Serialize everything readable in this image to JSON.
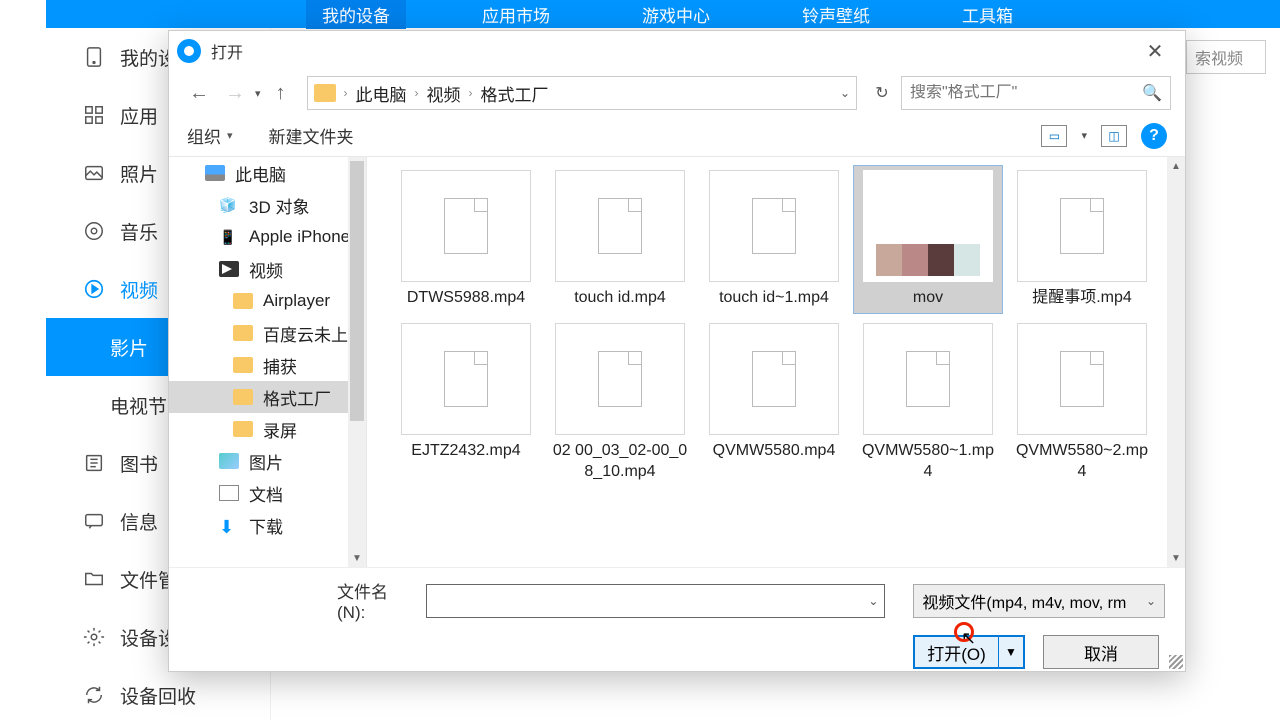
{
  "top_nav": {
    "items": [
      "我的设备",
      "应用市场",
      "游戏中心",
      "铃声壁纸",
      "工具箱"
    ],
    "active_index": 0
  },
  "search_bg_placeholder": "索视频",
  "sidebar": {
    "items": [
      {
        "label": "我的设",
        "icon": "device"
      },
      {
        "label": "应用",
        "icon": "apps"
      },
      {
        "label": "照片",
        "icon": "photo"
      },
      {
        "label": "音乐",
        "icon": "music"
      },
      {
        "label": "视频",
        "icon": "video",
        "active": true
      },
      {
        "label": "影片",
        "icon": "",
        "sub": true,
        "selected": true
      },
      {
        "label": "电视节",
        "icon": "",
        "sub": true
      },
      {
        "label": "图书",
        "icon": "book"
      },
      {
        "label": "信息",
        "icon": "message"
      },
      {
        "label": "文件管",
        "icon": "folder"
      },
      {
        "label": "设备设",
        "icon": "settings"
      },
      {
        "label": "设备回收",
        "icon": "recycle"
      }
    ]
  },
  "dialog": {
    "title": "打开",
    "breadcrumb": [
      "此电脑",
      "视频",
      "格式工厂"
    ],
    "search_placeholder": "搜索\"格式工厂\"",
    "toolbar": {
      "organize": "组织",
      "new_folder": "新建文件夹"
    },
    "tree": [
      {
        "label": "此电脑",
        "icon": "monitor",
        "indent": 0
      },
      {
        "label": "3D 对象",
        "icon": "3d",
        "indent": 1
      },
      {
        "label": "Apple iPhone",
        "icon": "phone",
        "indent": 1
      },
      {
        "label": "视频",
        "icon": "video-lib",
        "indent": 1
      },
      {
        "label": "Airplayer",
        "icon": "folder",
        "indent": 2
      },
      {
        "label": "百度云未上传",
        "icon": "folder",
        "indent": 2
      },
      {
        "label": "捕获",
        "icon": "folder",
        "indent": 2
      },
      {
        "label": "格式工厂",
        "icon": "folder",
        "indent": 2,
        "selected": true
      },
      {
        "label": "录屏",
        "icon": "folder",
        "indent": 2
      },
      {
        "label": "图片",
        "icon": "pic",
        "indent": 1
      },
      {
        "label": "文档",
        "icon": "doc",
        "indent": 1
      },
      {
        "label": "下载",
        "icon": "download",
        "indent": 1
      }
    ],
    "files": [
      {
        "name": "DTWS5988.mp4",
        "thumb": "blank"
      },
      {
        "name": "touch id.mp4",
        "thumb": "blank"
      },
      {
        "name": "touch id~1.mp4",
        "thumb": "blank"
      },
      {
        "name": "mov",
        "thumb": "strip",
        "selected": true
      },
      {
        "name": "提醒事项.mp4",
        "thumb": "blank"
      },
      {
        "name": "EJTZ2432.mp4",
        "thumb": "blank"
      },
      {
        "name": "02 00_03_02-00_08_10.mp4",
        "thumb": "blank"
      },
      {
        "name": "QVMW5580.mp4",
        "thumb": "blank"
      },
      {
        "name": "QVMW5580~1.mp4",
        "thumb": "blank"
      },
      {
        "name": "QVMW5580~2.mp4",
        "thumb": "blank"
      }
    ],
    "filename_label": "文件名(N):",
    "filename_value": "",
    "filter_label": "视频文件(mp4, m4v, mov, rm",
    "open_button": "打开(O)",
    "cancel_button": "取消"
  }
}
